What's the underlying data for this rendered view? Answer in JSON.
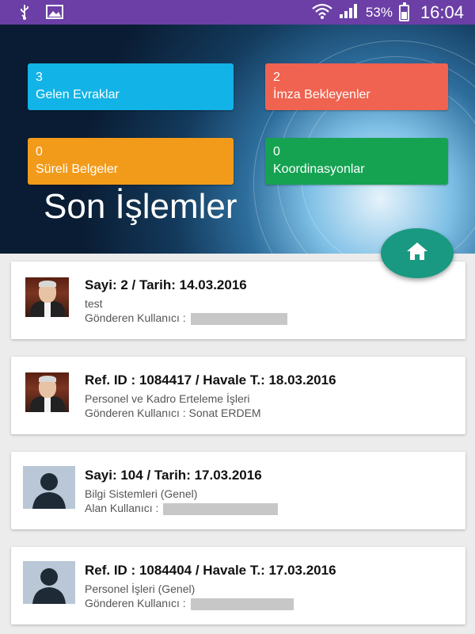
{
  "status_bar": {
    "battery": "53%",
    "time": "16:04"
  },
  "tiles": {
    "gelen": {
      "count": "3",
      "label": "Gelen Evraklar",
      "color": "#12b3e6"
    },
    "imza": {
      "count": "2",
      "label": "İmza Bekleyenler",
      "color": "#ef6350"
    },
    "sureli": {
      "count": "0",
      "label": "Süreli Belgeler",
      "color": "#f29b1b"
    },
    "koord": {
      "count": "0",
      "label": "Koordinasyonlar",
      "color": "#15a352"
    }
  },
  "section_title": "Son İşlemler",
  "fab_icon": "home-icon",
  "cards": [
    {
      "title": "Sayi: 2 / Tarih: 14.03.2016",
      "subtitle": "test",
      "user_label": "Gönderen Kullanıcı :",
      "user_value": "",
      "avatar": "photo"
    },
    {
      "title": "Ref. ID : 1084417 / Havale T.: 18.03.2016",
      "subtitle": "Personel ve Kadro Erteleme İşleri",
      "user_label": "Gönderen Kullanıcı :",
      "user_value": "Sonat ERDEM",
      "avatar": "photo"
    },
    {
      "title": "Sayi: 104 / Tarih: 17.03.2016",
      "subtitle": "Bilgi Sistemleri (Genel)",
      "user_label": "Alan Kullanıcı :",
      "user_value": "",
      "avatar": "silhouette"
    },
    {
      "title": "Ref. ID : 1084404 / Havale T.: 17.03.2016",
      "subtitle": "Personel İşleri (Genel)",
      "user_label": "Gönderen Kullanıcı :",
      "user_value": "",
      "avatar": "silhouette"
    }
  ]
}
